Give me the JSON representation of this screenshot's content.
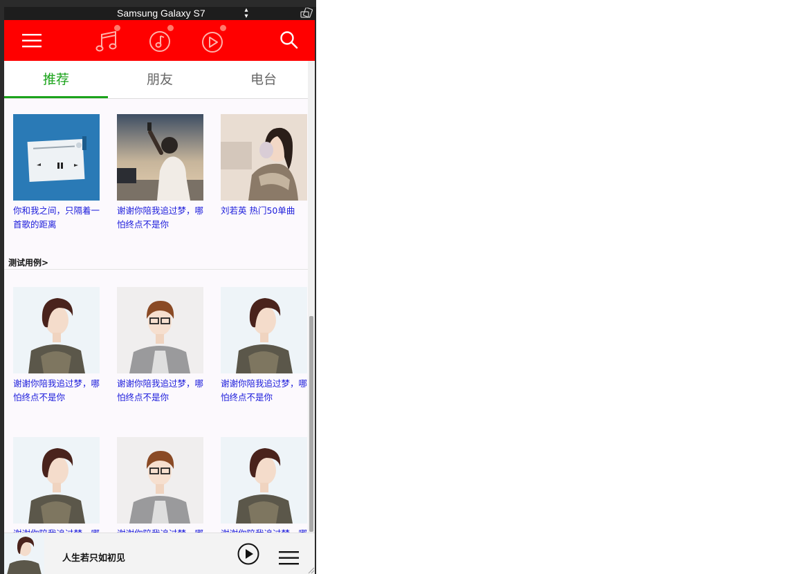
{
  "device": {
    "name": "Samsung Galaxy S7",
    "select_arrows": "⬍"
  },
  "header": {
    "menu_icon": "hamburger-menu-icon",
    "icons": [
      "music-note-icon",
      "music-disc-icon",
      "video-play-icon",
      "search-icon"
    ],
    "background": "#ff0000",
    "badge_color": "#ff7a6b"
  },
  "tabs": [
    {
      "label": "推荐",
      "active": true
    },
    {
      "label": "朋友",
      "active": false
    },
    {
      "label": "电台",
      "active": false
    }
  ],
  "accent_color": "#1aa31a",
  "caption_color": "#1a1adb",
  "recommend": [
    {
      "caption": "你和我之间，只隔着一首歌的距离",
      "image": "music-player-album-cover"
    },
    {
      "caption": "谢谢你陪我追过梦，哪怕终点不是你",
      "image": "man-with-phone-cover"
    },
    {
      "caption": "刘若英 热门50单曲",
      "image": "woman-with-earmuffs-cover"
    }
  ],
  "section": {
    "title": "测试用例>"
  },
  "test_cases": [
    {
      "caption": "谢谢你陪我追过梦，哪怕终点不是你",
      "image": "female-singer-photo"
    },
    {
      "caption": "谢谢你陪我追过梦，哪怕终点不是你",
      "image": "male-singer-photo"
    },
    {
      "caption": "谢谢你陪我追过梦，哪怕终点不是你",
      "image": "female-singer-photo"
    },
    {
      "caption": "谢谢你陪我追过梦，哪怕终点不是你",
      "image": "female-singer-photo"
    },
    {
      "caption": "谢谢你陪我追过梦，哪怕终点不是你",
      "image": "male-singer-photo"
    },
    {
      "caption": "谢谢你陪我追过梦，哪怕终点不是你",
      "image": "female-singer-photo"
    }
  ],
  "player": {
    "title": "人生若只如初见",
    "play_icon": "play-circle-icon",
    "playlist_icon": "playlist-menu-icon"
  }
}
